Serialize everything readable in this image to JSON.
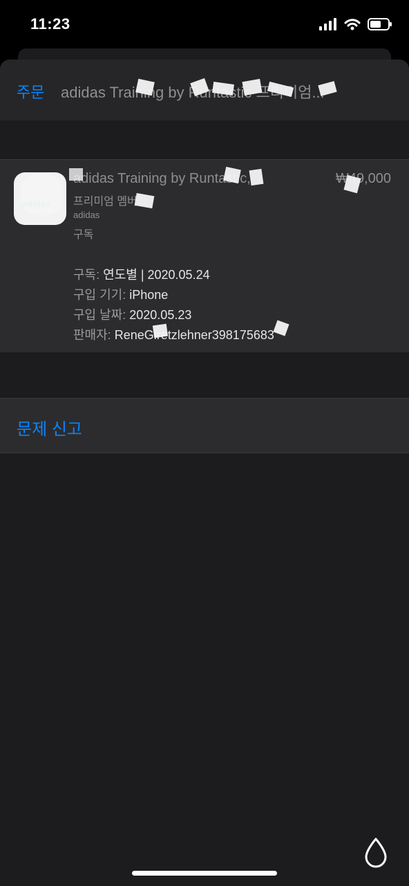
{
  "status_bar": {
    "time": "11:23"
  },
  "nav": {
    "back_label": "주문",
    "title": "adidas Training by Runtastic 프리미엄..."
  },
  "item": {
    "app_name": "adidas Training by Runtastic,",
    "app_subtitle": "프리미엄 멤버십",
    "developer": "adidas",
    "kind": "구독",
    "price": "₩49,000",
    "details": [
      {
        "label": "구독:",
        "value": "연도별 | 2020.05.24"
      },
      {
        "label": "구입 기기:",
        "value": "iPhone"
      },
      {
        "label": "구입 날짜:",
        "value": "2020.05.23"
      },
      {
        "label": "판매자:",
        "value": "ReneGiretzlehner398175683"
      }
    ]
  },
  "report": {
    "label": "문제 신고"
  },
  "colors": {
    "accent": "#0a84ff",
    "background": "#1c1c1e",
    "cell": "#2c2c2e"
  },
  "icons": [
    "cellular-signal-icon",
    "wifi-icon",
    "battery-icon",
    "water-drop-icon"
  ]
}
